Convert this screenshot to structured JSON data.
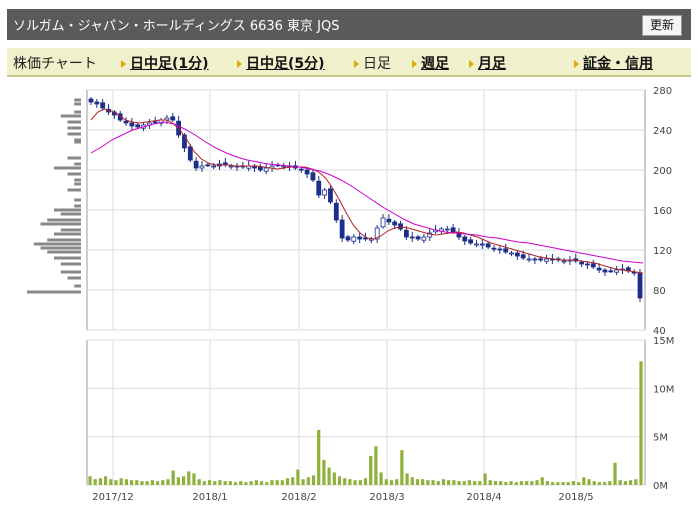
{
  "header": {
    "title": "ソルガム・ジャパン・ホールディングス 6636 東京 JQS",
    "refresh_label": "更新"
  },
  "nav": {
    "items": [
      {
        "label": "株価チャート",
        "type": "current"
      },
      {
        "label": "日中足(1分)",
        "type": "link"
      },
      {
        "label": "日中足(5分)",
        "type": "link"
      },
      {
        "label": "日足",
        "type": "current"
      },
      {
        "label": "週足",
        "type": "link"
      },
      {
        "label": "月足",
        "type": "link"
      },
      {
        "label": "証金・信用",
        "type": "link"
      }
    ]
  },
  "colors": {
    "candle_up": "#ffffff",
    "candle_down": "#1c2f8a",
    "ma_short": "#b22222",
    "ma_long": "#cc00cc",
    "volume": "#8fb03a",
    "price_profile": "#888888"
  },
  "chart_data": [
    {
      "type": "candlestick",
      "title": "",
      "ylim": [
        40,
        280
      ],
      "y_ticks": [
        "280",
        "240",
        "200",
        "160",
        "120",
        "80",
        "40"
      ],
      "x_ticks": [
        "2017/12",
        "2018/1",
        "2018/2",
        "2018/3",
        "2018/4",
        "2018/5"
      ],
      "grid": true,
      "close": [
        268,
        266,
        262,
        258,
        255,
        250,
        247,
        244,
        243,
        245,
        247,
        248,
        250,
        252,
        250,
        235,
        222,
        210,
        202,
        204,
        205,
        204,
        206,
        205,
        204,
        203,
        203,
        204,
        202,
        200,
        202,
        204,
        205,
        204,
        203,
        202,
        200,
        196,
        190,
        175,
        180,
        168,
        150,
        132,
        130,
        133,
        131,
        131,
        131,
        142,
        152,
        148,
        145,
        141,
        133,
        132,
        131,
        133,
        137,
        140,
        141,
        141,
        138,
        133,
        129,
        127,
        126,
        125,
        123,
        121,
        120,
        118,
        117,
        114,
        112,
        111,
        110,
        110,
        111,
        110,
        110,
        109,
        110,
        109,
        106,
        105,
        103,
        100,
        98,
        99,
        100,
        101,
        99,
        97,
        72
      ],
      "series": [
        {
          "name": "",
          "kind": "ma",
          "values": [
            250,
            258,
            261,
            259,
            255,
            250,
            248,
            247,
            248,
            249,
            250,
            250,
            246,
            239,
            229,
            218,
            211,
            207,
            205,
            205,
            205,
            204,
            204,
            204,
            204,
            203,
            202,
            201,
            202,
            203,
            203,
            203,
            201,
            198,
            192,
            182,
            170,
            157,
            145,
            137,
            132,
            131,
            134,
            139,
            142,
            143,
            142,
            140,
            138,
            136,
            135,
            136,
            137,
            138,
            137,
            135,
            133,
            130,
            127,
            125,
            123,
            121,
            119,
            117,
            115,
            113,
            112,
            111,
            110,
            110,
            110,
            109,
            108,
            107,
            105,
            103,
            101,
            100,
            99,
            98,
            97
          ]
        },
        {
          "name": "",
          "kind": "ma",
          "values": [
            217,
            223,
            230,
            235,
            240,
            243,
            246,
            248,
            246,
            241,
            235,
            228,
            222,
            217,
            213,
            210,
            208,
            206,
            205,
            204,
            203,
            201,
            199,
            195,
            190,
            184,
            177,
            170,
            163,
            157,
            151,
            146,
            143,
            140,
            138,
            137,
            136,
            135,
            133,
            132,
            130,
            128,
            127,
            125,
            123,
            121,
            119,
            117,
            115,
            113,
            111,
            109,
            108,
            107
          ]
        }
      ]
    },
    {
      "type": "bar",
      "title": "",
      "ylim": [
        0,
        15
      ],
      "y_ticks": [
        "15M",
        "10M",
        "5M",
        "0M"
      ],
      "values": [
        0.9,
        0.6,
        0.7,
        0.9,
        0.6,
        0.5,
        0.7,
        0.6,
        0.5,
        0.5,
        0.4,
        0.4,
        0.5,
        0.4,
        0.5,
        0.6,
        1.5,
        0.8,
        0.9,
        1.4,
        1.2,
        0.6,
        0.4,
        0.5,
        0.4,
        0.5,
        0.4,
        0.4,
        0.3,
        0.4,
        0.3,
        0.4,
        0.5,
        0.4,
        0.3,
        0.5,
        0.5,
        0.5,
        0.7,
        0.8,
        1.6,
        0.6,
        0.8,
        1.0,
        5.7,
        2.6,
        1.8,
        1.3,
        0.9,
        0.7,
        0.6,
        0.5,
        0.5,
        0.7,
        3.0,
        4.0,
        1.3,
        0.6,
        0.5,
        0.6,
        3.6,
        1.2,
        0.8,
        0.6,
        0.6,
        0.5,
        0.5,
        0.4,
        0.6,
        0.5,
        0.5,
        0.4,
        0.4,
        0.5,
        0.4,
        0.4,
        1.2,
        0.5,
        0.4,
        0.4,
        0.3,
        0.4,
        0.3,
        0.4,
        0.4,
        0.4,
        0.5,
        0.8,
        0.4,
        0.3,
        0.3,
        0.3,
        0.3,
        0.4,
        0.3,
        0.8,
        0.6,
        0.4,
        0.3,
        0.3,
        0.4,
        2.3,
        0.5,
        0.4,
        0.5,
        0.6,
        12.8
      ]
    },
    {
      "type": "bar",
      "title": "",
      "orientation": "horizontal",
      "price_levels": [
        270,
        266,
        258,
        254,
        248,
        242,
        236,
        230,
        228,
        212,
        206,
        202,
        196,
        190,
        186,
        180,
        170,
        164,
        160,
        156,
        150,
        146,
        140,
        136,
        130,
        126,
        122,
        118,
        112,
        106,
        98,
        92,
        84,
        78
      ],
      "values": [
        1,
        1,
        1,
        3,
        2,
        2,
        2,
        1,
        1,
        2,
        1,
        4,
        2,
        1,
        1,
        2,
        1,
        1,
        4,
        3,
        5,
        6,
        3,
        4,
        5,
        7,
        6,
        5,
        4,
        3,
        3,
        2,
        1,
        8
      ]
    }
  ]
}
